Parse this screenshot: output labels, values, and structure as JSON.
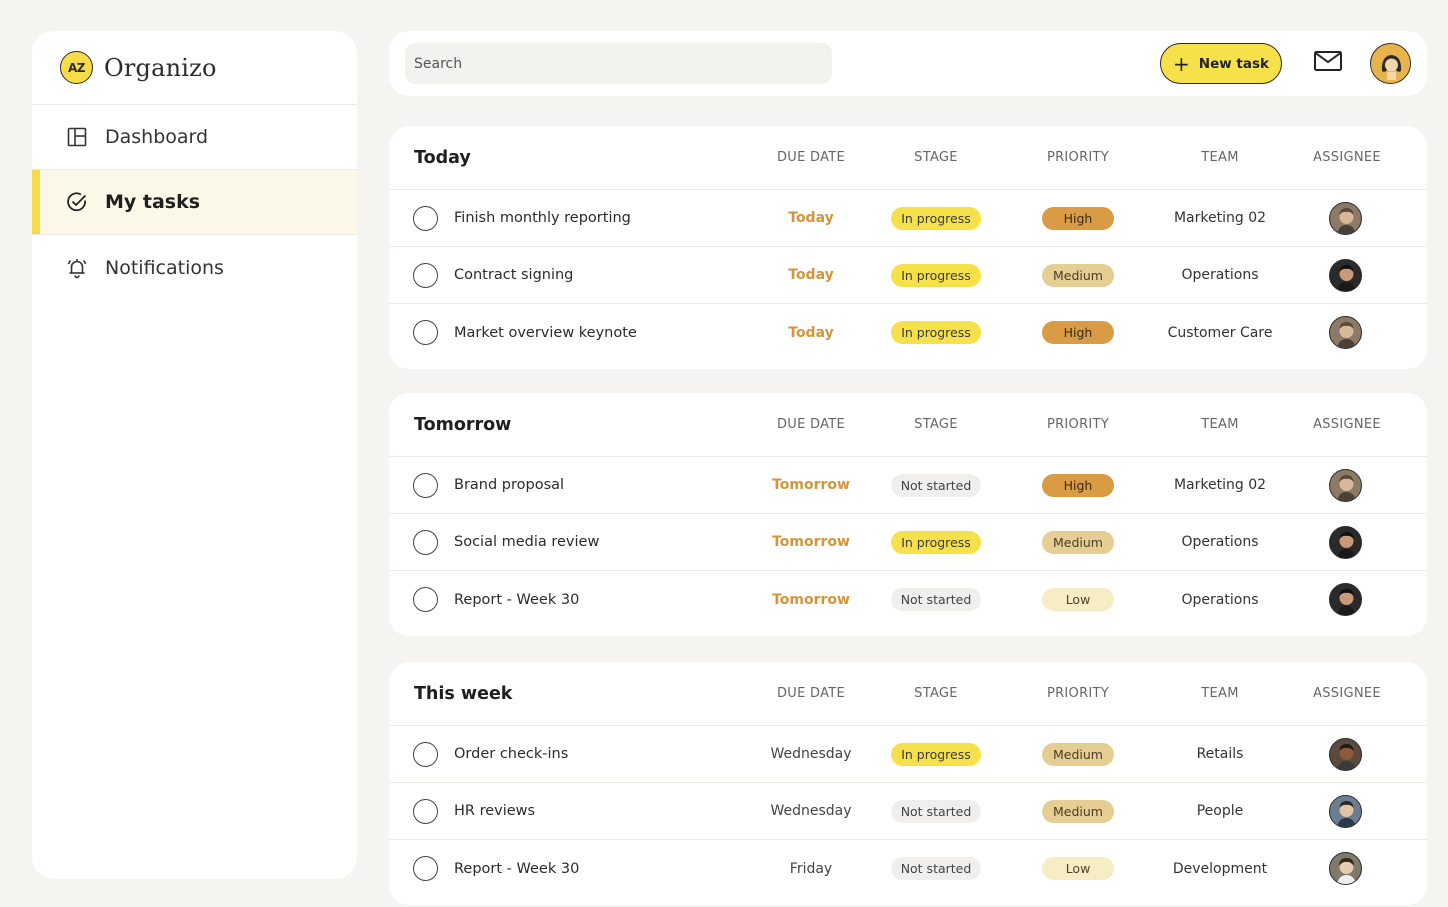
{
  "app": {
    "logo_text": "AZ",
    "name": "Organizo"
  },
  "sidebar": {
    "items": [
      {
        "label": "Dashboard",
        "icon": "dashboard-icon",
        "active": false
      },
      {
        "label": "My tasks",
        "icon": "check-circle-icon",
        "active": true
      },
      {
        "label": "Notifications",
        "icon": "bell-icon",
        "active": false
      }
    ]
  },
  "topbar": {
    "search_placeholder": "Search",
    "new_task_label": "New task",
    "mail_icon": "mail-icon",
    "avatar_icon": "user-avatar-icon"
  },
  "columns": {
    "due": "DUE DATE",
    "stage": "STAGE",
    "priority": "PRIORITY",
    "team": "TEAM",
    "assignee": "ASSIGNEE"
  },
  "colors": {
    "accent": "#f7dc4a",
    "due_highlight": "#d4953a",
    "priority_high": "#d99c45",
    "priority_medium": "#e5cd93",
    "priority_low": "#f7edc5"
  },
  "groups": [
    {
      "title": "Today",
      "tasks": [
        {
          "name": "Finish monthly reporting",
          "due": "Today",
          "stage": "In progress",
          "priority": "High",
          "team": "Marketing 02",
          "assignee": "a"
        },
        {
          "name": "Contract signing",
          "due": "Today",
          "stage": "In progress",
          "priority": "Medium",
          "team": "Operations",
          "assignee": "b"
        },
        {
          "name": "Market overview keynote",
          "due": "Today",
          "stage": "In progress",
          "priority": "High",
          "team": "Customer Care",
          "assignee": "a"
        }
      ]
    },
    {
      "title": "Tomorrow",
      "tasks": [
        {
          "name": "Brand proposal",
          "due": "Tomorrow",
          "stage": "Not started",
          "priority": "High",
          "team": "Marketing 02",
          "assignee": "a"
        },
        {
          "name": "Social media review",
          "due": "Tomorrow",
          "stage": "In progress",
          "priority": "Medium",
          "team": "Operations",
          "assignee": "b"
        },
        {
          "name": "Report - Week 30",
          "due": "Tomorrow",
          "stage": "Not started",
          "priority": "Low",
          "team": "Operations",
          "assignee": "b"
        }
      ]
    },
    {
      "title": "This week",
      "tasks": [
        {
          "name": "Order check-ins",
          "due": "Wednesday",
          "stage": "In progress",
          "priority": "Medium",
          "team": "Retails",
          "assignee": "c"
        },
        {
          "name": "HR reviews",
          "due": "Wednesday",
          "stage": "Not started",
          "priority": "Medium",
          "team": "People",
          "assignee": "d"
        },
        {
          "name": "Report - Week 30",
          "due": "Friday",
          "stage": "Not started",
          "priority": "Low",
          "team": "Development",
          "assignee": "e"
        }
      ]
    }
  ]
}
